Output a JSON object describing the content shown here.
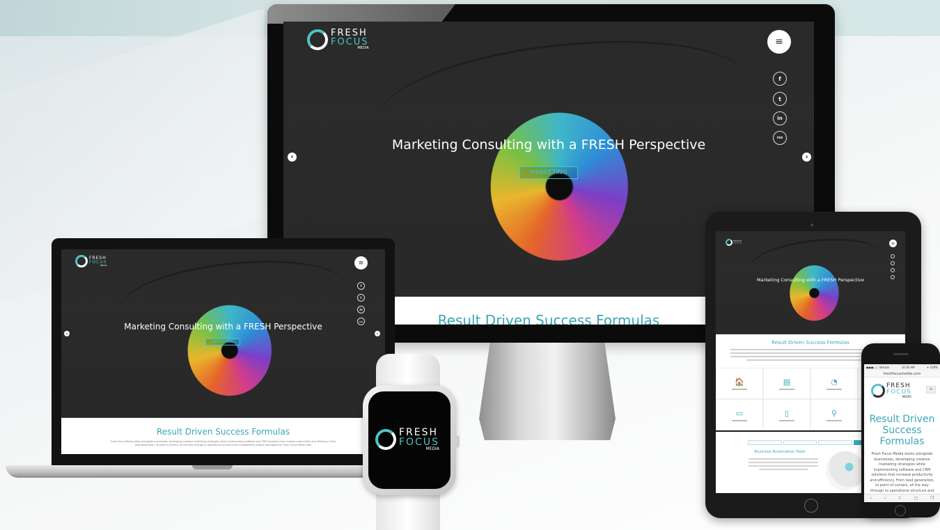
{
  "brand": {
    "fresh": "FRESH",
    "focus": "FOCUS",
    "media": "MEDIA"
  },
  "colors": {
    "accent": "#4fc2c7",
    "heading": "#3aa6b6",
    "screen_dark": "#0b0b0b"
  },
  "imac": {
    "hero_title": "Marketing Consulting with a FRESH Perspective",
    "hero_button": "MARKETING",
    "menu_icon": "hamburger-menu-icon",
    "social": [
      "facebook-icon",
      "twitter-icon",
      "linkedin-icon",
      "rss-icon"
    ],
    "social_glyphs": [
      "f",
      "t",
      "in",
      "rss"
    ],
    "section_title": "Result Driven Success Formulas",
    "arrow_left": "‹",
    "arrow_right": "›"
  },
  "laptop": {
    "hero_title": "Marketing Consulting with a FRESH Perspective",
    "hero_button": "MARKETING",
    "section_title": "Result Driven Success Formulas",
    "section_text": "Fresh Focus Media works alongside businesses, developing creative marketing strategies while implementing software and CRM solutions that increase productivity and efficiency. From lead generation, to point of contact, all the way through to operational structure and collaborative project management, Fresh Focus Media gets"
  },
  "tablet": {
    "hero_title": "Marketing Consulting with a FRESH Perspective",
    "section_title": "Result Driven Success Formulas",
    "icon_glyphs": [
      "🏠",
      "▤",
      "◔",
      "▥",
      "▭",
      "▯",
      "⚲",
      ""
    ],
    "lower_title": "Business Automation Tools"
  },
  "phone": {
    "url": "freshfocusmedia.com",
    "status_left": "●●●○○ Verizon",
    "status_center": "10:36 AM",
    "status_right": "✦ 100%",
    "title": "Result Driven Success Formulas",
    "text": "Fresh Focus Media works alongside businesses, developing creative marketing strategies while implementing software and CRM solutions that increase productivity and efficiency. From lead generation, to point of contact, all the way through to operational structure and collaborative",
    "toolbar": [
      "‹",
      "›",
      "⇧",
      "▢",
      "❐"
    ]
  }
}
